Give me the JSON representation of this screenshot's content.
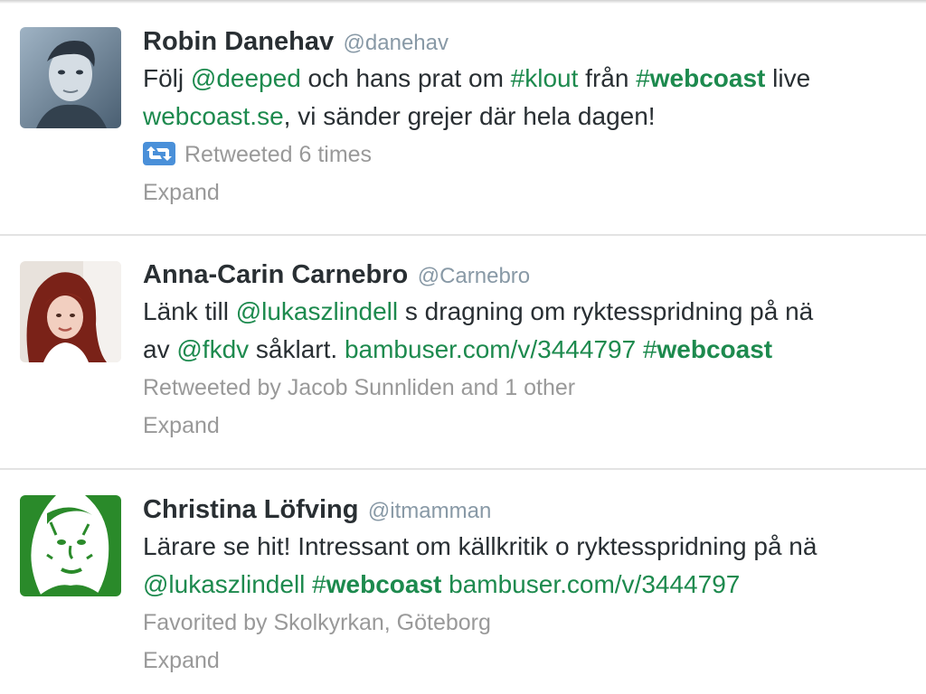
{
  "timeline": {
    "tweets": [
      {
        "fullname": "Robin Danehav",
        "username": "@danehav",
        "text": [
          {
            "t": "Följ ",
            "type": "plain"
          },
          {
            "t": "@deeped",
            "type": "link"
          },
          {
            "t": " och hans prat om ",
            "type": "plain"
          },
          {
            "t": "#klout",
            "type": "link"
          },
          {
            "t": " från ",
            "type": "plain"
          },
          {
            "t": "#",
            "type": "link"
          },
          {
            "t": "webcoast",
            "type": "link-bold"
          },
          {
            "t": " live",
            "type": "plain"
          }
        ],
        "text_line2": [
          {
            "t": "webcoast.se",
            "type": "link"
          },
          {
            "t": ", vi sänder grejer där hela dagen!",
            "type": "plain"
          }
        ],
        "meta": "Retweeted 6 times",
        "expand": "Expand"
      },
      {
        "fullname": "Anna-Carin Carnebro",
        "username": "@Carnebro",
        "text": [
          {
            "t": "Länk till ",
            "type": "plain"
          },
          {
            "t": "@lukaszlindell",
            "type": "link"
          },
          {
            "t": " s dragning om ryktesspridning på nä",
            "type": "plain"
          }
        ],
        "text_line2": [
          {
            "t": "av ",
            "type": "plain"
          },
          {
            "t": "@fkdv",
            "type": "link"
          },
          {
            "t": " såklart. ",
            "type": "plain"
          },
          {
            "t": "bambuser.com/v/3444797",
            "type": "link"
          },
          {
            "t": " ",
            "type": "plain"
          },
          {
            "t": "#",
            "type": "link"
          },
          {
            "t": "webcoast",
            "type": "link-bold"
          }
        ],
        "meta": "Retweeted by Jacob Sunnliden and 1 other",
        "expand": "Expand"
      },
      {
        "fullname": "Christina Löfving",
        "username": "@itmamman",
        "text": [
          {
            "t": "Lärare se hit! Intressant om källkritik o ryktesspridning på nä",
            "type": "plain"
          }
        ],
        "text_line2": [
          {
            "t": "@lukaszlindell",
            "type": "link"
          },
          {
            "t": " ",
            "type": "plain"
          },
          {
            "t": "#",
            "type": "link"
          },
          {
            "t": "webcoast",
            "type": "link-bold"
          },
          {
            "t": " ",
            "type": "plain"
          },
          {
            "t": "bambuser.com/v/3444797",
            "type": "link"
          }
        ],
        "meta": "Favorited by Skolkyrkan, Göteborg",
        "expand": "Expand"
      }
    ]
  },
  "colors": {
    "link": "#1d8a4e",
    "text": "#292f33",
    "muted": "#999999",
    "retweet_icon": "#4a90d9"
  }
}
